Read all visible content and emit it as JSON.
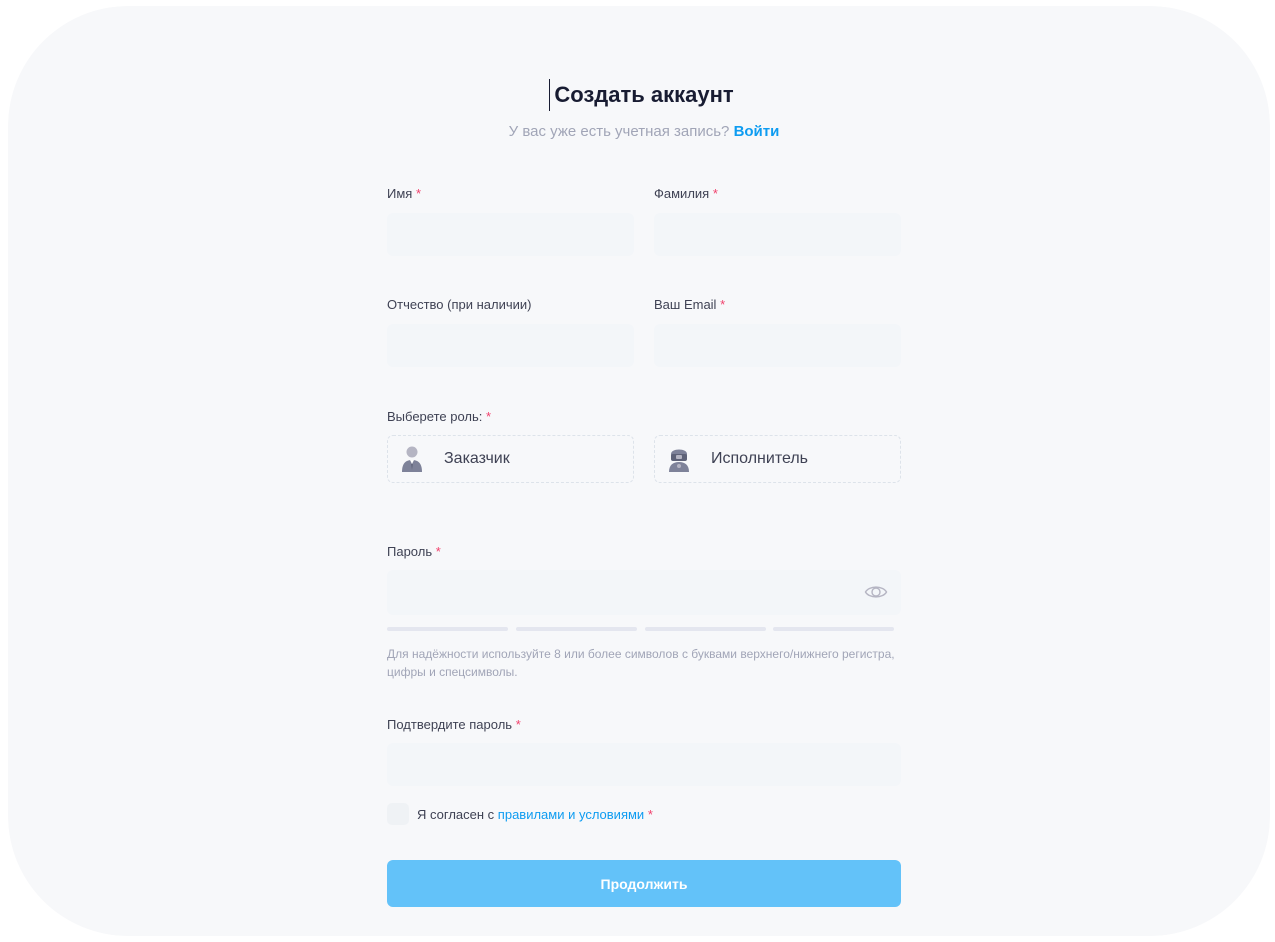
{
  "header": {
    "title": "Создать аккаунт",
    "subtitle_text": "У вас уже есть учетная запись?",
    "login_link": "Войти"
  },
  "fields": {
    "first_name": {
      "label": "Имя",
      "required_mark": "*",
      "value": "",
      "placeholder": ""
    },
    "last_name": {
      "label": "Фамилия",
      "required_mark": "*",
      "value": "",
      "placeholder": ""
    },
    "patronymic": {
      "label": "Отчество (при наличии)",
      "value": "",
      "placeholder": ""
    },
    "email": {
      "label": "Ваш Email",
      "required_mark": "*",
      "value": "",
      "placeholder": ""
    },
    "password": {
      "label": "Пароль",
      "required_mark": "*",
      "value": "",
      "placeholder": ""
    },
    "confirm_password": {
      "label": "Подтвердите пароль",
      "required_mark": "*",
      "value": "",
      "placeholder": ""
    }
  },
  "role": {
    "label": "Выберете роль:",
    "required_mark": "*",
    "options": [
      {
        "label": "Заказчик",
        "icon": "customer-icon"
      },
      {
        "label": "Исполнитель",
        "icon": "executor-icon"
      }
    ]
  },
  "password_hint": "Для надёжности используйте 8 или более символов с буквами верхнего/нижнего регистра, цифры и спецсимволы.",
  "agreement": {
    "text": "Я согласен с",
    "link": "правилами и условиями",
    "required_mark": "*",
    "checked": false
  },
  "submit_label": "Продолжить",
  "colors": {
    "accent": "#0e9cf1",
    "button": "#63c2f9",
    "required": "#f1416c",
    "input_bg": "#f3f6f9"
  }
}
